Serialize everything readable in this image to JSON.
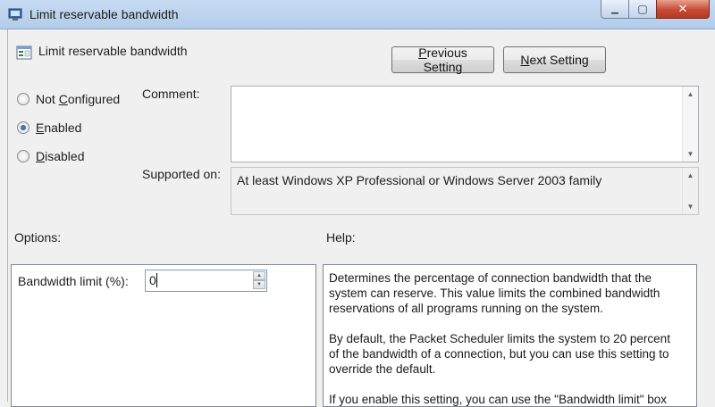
{
  "window": {
    "title": "Limit reservable bandwidth",
    "min_glyph": "▁",
    "max_glyph": "▢",
    "close_glyph": "✕"
  },
  "header": {
    "title": "Limit reservable bandwidth",
    "prev_button": {
      "prefix": "",
      "accel": "P",
      "rest": "revious Setting"
    },
    "next_button": {
      "prefix": "",
      "accel": "N",
      "rest": "ext Setting"
    }
  },
  "state": {
    "options": [
      {
        "prefix": "Not ",
        "accel": "C",
        "rest": "onfigured",
        "checked": false
      },
      {
        "prefix": "",
        "accel": "E",
        "rest": "nabled",
        "checked": true
      },
      {
        "prefix": "",
        "accel": "D",
        "rest": "isabled",
        "checked": false
      }
    ]
  },
  "comment": {
    "label": "Comment:",
    "value": ""
  },
  "supported_on": {
    "label": "Supported on:",
    "value": "At least Windows XP Professional or Windows Server 2003 family"
  },
  "options_section": {
    "label": "Options:",
    "bandwidth_label": "Bandwidth limit (%):",
    "bandwidth_value": "0"
  },
  "help_section": {
    "label": "Help:",
    "paragraphs": [
      "Determines the percentage of connection bandwidth that the system can reserve. This value limits the combined bandwidth reservations of all programs running on the system.",
      "By default, the Packet Scheduler limits the system to 20 percent of the bandwidth of a connection, but you can use this setting to override the default.",
      "If you enable this setting, you can use the \"Bandwidth limit\" box"
    ]
  },
  "icons": {
    "scroll_up": "▲",
    "scroll_down": "▼"
  }
}
